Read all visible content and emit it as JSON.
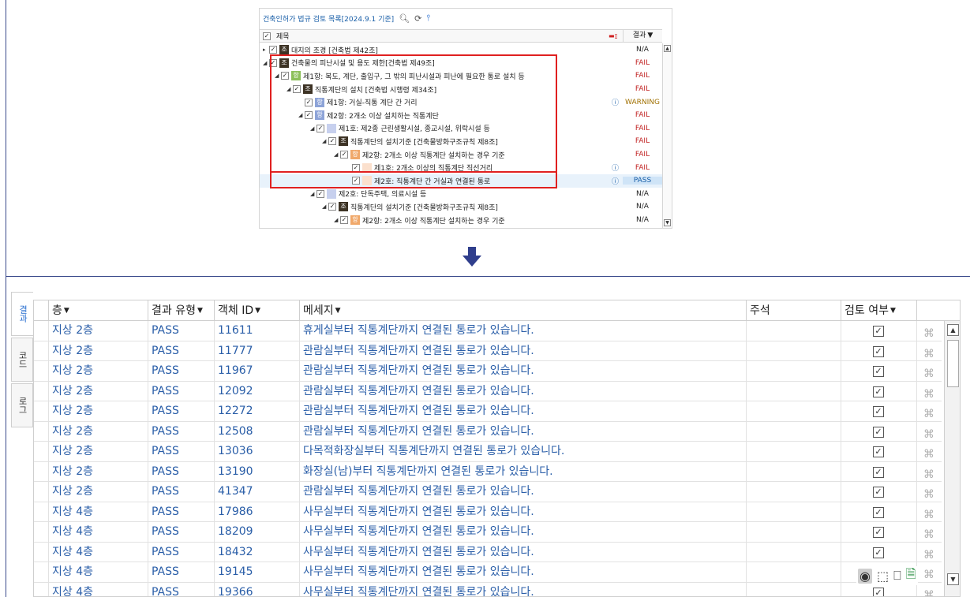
{
  "tree": {
    "title": "건축인허가 법규 검토 목록[2024.9.1 기준]",
    "header_title": "제목",
    "header_result": "결과",
    "rows": [
      {
        "level": 0,
        "toggle": "▸",
        "tag": "조",
        "tag_style": "jo",
        "text": "대지의 조경 [건축법 제42조]",
        "result": "N/A",
        "result_style": "na",
        "info": ""
      },
      {
        "level": 0,
        "toggle": "◢",
        "tag": "조",
        "tag_style": "jo",
        "text": "건축물의 피난시설 및 용도 제한[건축법 제49조]",
        "result": "FAIL",
        "result_style": "fail",
        "info": ""
      },
      {
        "level": 1,
        "toggle": "◢",
        "tag": "항",
        "tag_style": "hang-g",
        "text": "제1항: 복도, 계단, 출입구, 그 밖의 피난시설과 피난에 필요한 통로 설치 등",
        "result": "FAIL",
        "result_style": "fail",
        "info": ""
      },
      {
        "level": 2,
        "toggle": "◢",
        "tag": "조",
        "tag_style": "jo",
        "text": "직통계단의 설치 [건축법 시행령 제34조]",
        "result": "FAIL",
        "result_style": "fail",
        "info": ""
      },
      {
        "level": 3,
        "toggle": "",
        "tag": "항",
        "tag_style": "hang-b",
        "text": "제1항: 거실-직통 계단 간 거리",
        "result": "WARNING",
        "result_style": "warn",
        "info": "ⓘ"
      },
      {
        "level": 3,
        "toggle": "◢",
        "tag": "항",
        "tag_style": "hang-b",
        "text": "제2항: 2개소 이상 설치하는 직통계단",
        "result": "FAIL",
        "result_style": "fail",
        "info": ""
      },
      {
        "level": 4,
        "toggle": "◢",
        "tag": "",
        "tag_style": "ho-l",
        "text": "제1호: 제2종 근린생활시설, 종교시설, 위락시설 등",
        "result": "FAIL",
        "result_style": "fail",
        "info": ""
      },
      {
        "level": 5,
        "toggle": "◢",
        "tag": "조",
        "tag_style": "jo",
        "text": "직통계단의 설치기준 [건축물방화구조규칙 제8조]",
        "result": "FAIL",
        "result_style": "fail",
        "info": ""
      },
      {
        "level": 6,
        "toggle": "◢",
        "tag": "항",
        "tag_style": "hang-o",
        "text": "제2항: 2개소 이상 직통계단 설치하는 경우 기준",
        "result": "FAIL",
        "result_style": "fail",
        "info": ""
      },
      {
        "level": 7,
        "toggle": "",
        "tag": "",
        "tag_style": "ho-p",
        "text": "제1호: 2개소 이상의 직통계단 직선거리",
        "result": "FAIL",
        "result_style": "fail",
        "info": "ⓘ"
      },
      {
        "level": 7,
        "toggle": "",
        "tag": "",
        "tag_style": "ho-p",
        "text": "제2호: 직통계단 간 거실과 연결된 통로",
        "result": "PASS",
        "result_style": "pass",
        "info": "ⓘ"
      },
      {
        "level": 4,
        "toggle": "◢",
        "tag": "",
        "tag_style": "ho-l",
        "text": "제2호: 단독주택, 의료시설 등",
        "result": "N/A",
        "result_style": "na",
        "info": ""
      },
      {
        "level": 5,
        "toggle": "◢",
        "tag": "조",
        "tag_style": "jo",
        "text": "직통계단의 설치기준 [건축물방화구조규칙 제8조]",
        "result": "N/A",
        "result_style": "na",
        "info": ""
      },
      {
        "level": 6,
        "toggle": "◢",
        "tag": "항",
        "tag_style": "hang-o",
        "text": "제2항: 2개소 이상 직통계단 설치하는 경우 기준",
        "result": "N/A",
        "result_style": "na",
        "info": ""
      }
    ]
  },
  "side_tabs": [
    "결과",
    "코드",
    "로그"
  ],
  "grid": {
    "columns": [
      "층",
      "결과 유형",
      "객체 ID",
      "메세지",
      "주석",
      "검토 여부"
    ],
    "rows": [
      {
        "floor": "지상 2층",
        "result": "PASS",
        "id": "11611",
        "message": "휴게실부터 직통계단까지 연결된 통로가 있습니다.",
        "note": "",
        "checked": "✓"
      },
      {
        "floor": "지상 2층",
        "result": "PASS",
        "id": "11777",
        "message": "관람실부터 직통계단까지 연결된 통로가 있습니다.",
        "note": "",
        "checked": "✓"
      },
      {
        "floor": "지상 2층",
        "result": "PASS",
        "id": "11967",
        "message": "관람실부터 직통계단까지 연결된 통로가 있습니다.",
        "note": "",
        "checked": "✓"
      },
      {
        "floor": "지상 2층",
        "result": "PASS",
        "id": "12092",
        "message": "관람실부터 직통계단까지 연결된 통로가 있습니다.",
        "note": "",
        "checked": "✓"
      },
      {
        "floor": "지상 2층",
        "result": "PASS",
        "id": "12272",
        "message": "관람실부터 직통계단까지 연결된 통로가 있습니다.",
        "note": "",
        "checked": "✓"
      },
      {
        "floor": "지상 2층",
        "result": "PASS",
        "id": "12508",
        "message": "관람실부터 직통계단까지 연결된 통로가 있습니다.",
        "note": "",
        "checked": "✓"
      },
      {
        "floor": "지상 2층",
        "result": "PASS",
        "id": "13036",
        "message": "다목적화장실부터 직통계단까지 연결된 통로가 있습니다.",
        "note": "",
        "checked": "✓"
      },
      {
        "floor": "지상 2층",
        "result": "PASS",
        "id": "13190",
        "message": "화장실(남)부터 직통계단까지 연결된 통로가 있습니다.",
        "note": "",
        "checked": "✓"
      },
      {
        "floor": "지상 2층",
        "result": "PASS",
        "id": "41347",
        "message": "관람실부터 직통계단까지 연결된 통로가 있습니다.",
        "note": "",
        "checked": "✓"
      },
      {
        "floor": "지상 4층",
        "result": "PASS",
        "id": "17986",
        "message": "사무실부터 직통계단까지 연결된 통로가 있습니다.",
        "note": "",
        "checked": "✓"
      },
      {
        "floor": "지상 4층",
        "result": "PASS",
        "id": "18209",
        "message": "사무실부터 직통계단까지 연결된 통로가 있습니다.",
        "note": "",
        "checked": "✓"
      },
      {
        "floor": "지상 4층",
        "result": "PASS",
        "id": "18432",
        "message": "사무실부터 직통계단까지 연결된 통로가 있습니다.",
        "note": "",
        "checked": "✓"
      },
      {
        "floor": "지상 4층",
        "result": "PASS",
        "id": "19145",
        "message": "사무실부터 직통계단까지 연결된 통로가 있습니다.",
        "note": "",
        "checked": "✓"
      },
      {
        "floor": "지상 4층",
        "result": "PASS",
        "id": "19366",
        "message": "사무실부터 직통계단까지 연결된 통로가 있습니다.",
        "note": "",
        "checked": "✓"
      }
    ]
  },
  "icons": {
    "search": "search-icon",
    "refresh": "refresh-icon",
    "hierarchy": "hierarchy-icon",
    "view": "eye-icon",
    "select_region": "select-region-icon",
    "split": "split-icon",
    "export": "excel-export-icon"
  },
  "colors": {
    "fail": "#c02020",
    "pass": "#1a5fa8",
    "warning": "#a07000",
    "highlight_box": "#e02020"
  }
}
